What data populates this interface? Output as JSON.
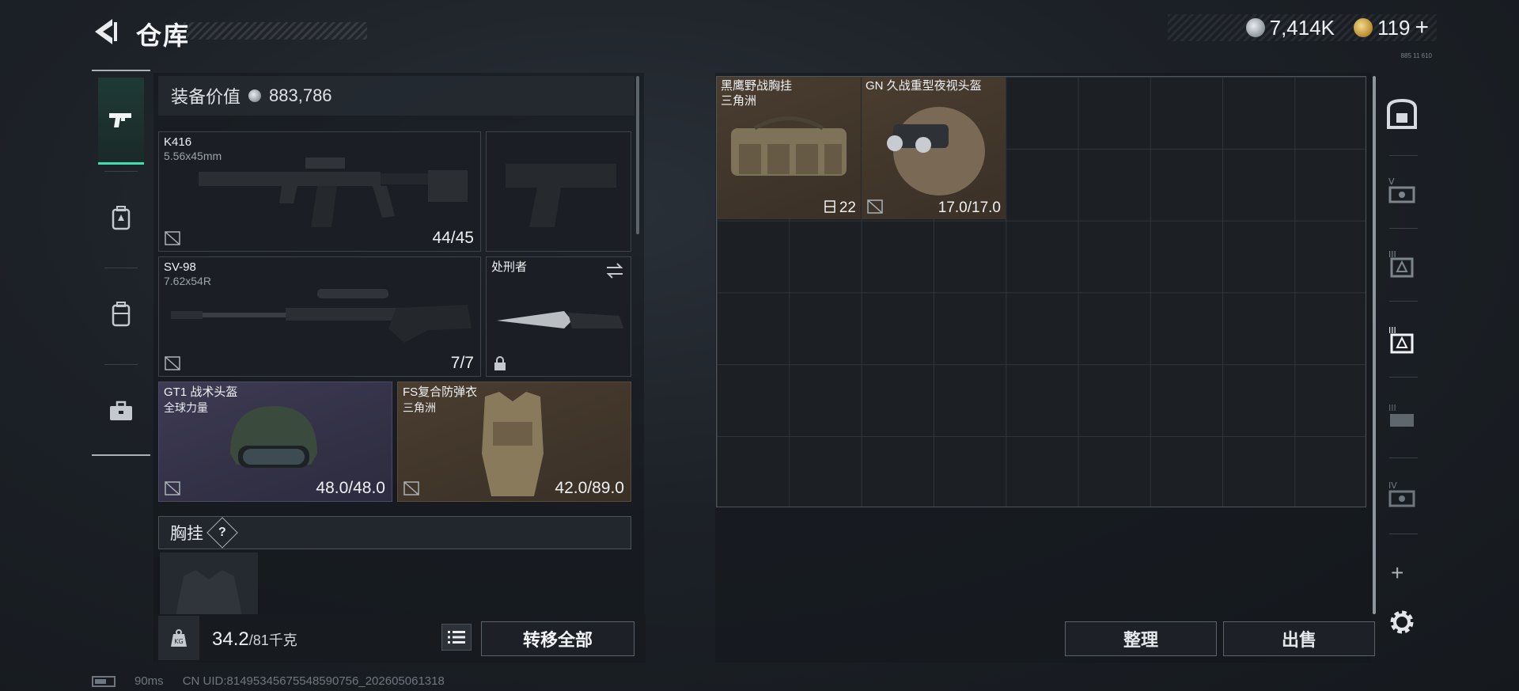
{
  "header": {
    "title": "仓库",
    "currency_silver": "7,414K",
    "currency_gold": "119",
    "add_symbol": "+",
    "tiny_code": "885 11 610"
  },
  "loadout": {
    "equip_value_label": "装备价值",
    "equip_value": "883,786",
    "slots": [
      {
        "name": "K416",
        "sub": "5.56x45mm",
        "value": "44/45"
      },
      {
        "name": "SV-98",
        "sub": "7.62x54R",
        "value": "7/7"
      },
      {
        "name": "处刑者",
        "sub": "",
        "value": ""
      },
      {
        "name": "GT1 战术头盔",
        "sub": "全球力量",
        "value": "48.0/48.0"
      },
      {
        "name": "FS复合防弹衣",
        "sub": "三角洲",
        "value": "42.0/89.0"
      }
    ],
    "chest_rig_label": "胸挂",
    "help_symbol": "?",
    "weight_current": "34.2",
    "weight_max": "/81千克",
    "weight_icon_text": "KG",
    "transfer_all": "转移全部"
  },
  "storage": {
    "items": [
      {
        "name": "黑鹰野战胸挂",
        "sub": "三角洲",
        "value": "22"
      },
      {
        "name": "GN 久战重型夜视头盔",
        "sub": "",
        "value": "17.0/17.0"
      }
    ],
    "grid": {
      "columns": 9,
      "rows": 6
    },
    "sort_button": "整理",
    "sell_button": "出售",
    "add_symbol": "+"
  },
  "status": {
    "ping": "90ms",
    "uid": "CN UID:81495345675548590756_202605061318"
  },
  "colors": {
    "accent": "#3fe0b0",
    "brown_rarity": "#4a3d30",
    "purple_rarity": "#3d3a52"
  },
  "icons": {
    "left_nav": [
      "pistol-icon",
      "backpack-tag-icon",
      "backpack-icon",
      "toolbox-icon"
    ],
    "right_nav": [
      "safe-box-icon",
      "container-v-icon",
      "container-iii-icon",
      "container-iii-active-icon",
      "container-iii-b-icon",
      "container-iv-icon"
    ]
  }
}
